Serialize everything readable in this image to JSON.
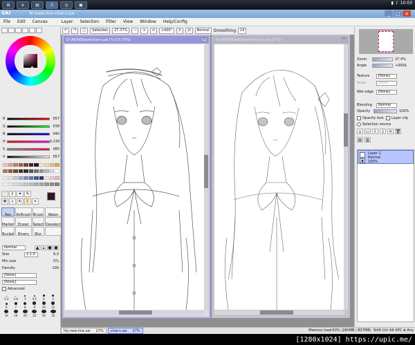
{
  "taskbar": {
    "app_name": "SAI",
    "file_label": "W:\\new-line-char-s.sai",
    "clock": "10:03"
  },
  "window": {
    "logo": "Paint Tool SAI",
    "title": "W:\\new-line-char-s.sai"
  },
  "menu": [
    "File",
    "Edit",
    "Canvas",
    "Layer",
    "Selection",
    "Filter",
    "View",
    "Window",
    "Help/Config"
  ],
  "toolbar": {
    "selection_label": "Selection",
    "zoom": "27.37%",
    "rotation": "+000°",
    "mode": "Normal",
    "smoothing_label": "Smoothing",
    "smoothing_value": "14"
  },
  "color": {
    "sliders": [
      {
        "label": "R",
        "value": "057",
        "colors": [
          "#000000",
          "#ff0000"
        ]
      },
      {
        "label": "G",
        "value": "038",
        "colors": [
          "#000000",
          "#00ff00"
        ]
      },
      {
        "label": "B",
        "value": "040",
        "colors": [
          "#000000",
          "#0000ff"
        ]
      },
      {
        "label": "H",
        "value": "S:230",
        "colors": [
          "#ff0000",
          "#ff00ff"
        ]
      },
      {
        "label": "S",
        "value": "085",
        "colors": [
          "#888888",
          "#ff0044"
        ]
      },
      {
        "label": "V",
        "value": "057",
        "colors": [
          "#000000",
          "#ffffff"
        ]
      }
    ],
    "swatches": [
      "#f3c9c2",
      "#e0a39a",
      "#c6836f",
      "#a06549",
      "#7a4b38",
      "#4a2a20",
      "#2c1a20",
      "#ffe6cc",
      "#ffd5a8",
      "#ecc189",
      "#d8a86a",
      "#b18255",
      "#8a6446",
      "#6d4c35",
      "#4b3322",
      "#333333",
      "#555555",
      "#777777",
      "#999999",
      "#bbbbbb",
      "#dddddd",
      "#ffffff",
      "#f0f0f0",
      "#e6e6e6",
      "#ccccdd",
      "#aab0cc",
      "#8890b8",
      "#6a7aa8",
      "#4a5a88",
      "#2a3a68",
      "#f7e4e4",
      "#edd0d0",
      "#e0bcbc",
      "#f5f5f5",
      "#eeeeee",
      "#e0e0e0",
      "#d8d8d8",
      "#cccccc",
      "#c0c0c0",
      "#b4b4b4",
      "#a8a8a8",
      "#9c9c9c",
      "#909090",
      "#848484"
    ]
  },
  "tools": {
    "brushes": [
      {
        "label": "Pen",
        "selected": true
      },
      {
        "label": "AirBrush",
        "selected": false
      },
      {
        "label": "Brush",
        "selected": false
      },
      {
        "label": "Water",
        "selected": false
      },
      {
        "label": "Marker",
        "selected": false
      },
      {
        "label": "Eraser",
        "selected": false
      },
      {
        "label": "Select",
        "selected": false
      },
      {
        "label": "Deselect",
        "selected": false
      },
      {
        "label": "Bucket",
        "selected": false
      },
      {
        "label": "Binary",
        "selected": false
      },
      {
        "label": "Blur",
        "selected": false
      },
      {
        "label": "",
        "selected": false
      }
    ],
    "blend_mode": "Normal",
    "size_label": "Size",
    "size_mult": "x 1.0",
    "size_value": "9.0",
    "min_size_label": "Min size",
    "min_size_value": "0%",
    "density_label": "Density",
    "density_value": "100",
    "texture_1": "[None]",
    "texture_2": "[None]",
    "advanced_label": "Advanced",
    "brush_sizes": [
      "2.3",
      "2.6",
      "3",
      "3.5",
      "4",
      "5",
      "6",
      "7",
      "8",
      "9",
      "10",
      "12",
      "14",
      "16",
      "20",
      "25",
      "30",
      "35"
    ]
  },
  "documents": [
    {
      "title": "D:\\AIDW\\Save\\char-s.sai (*) (27.37%)"
    },
    {
      "title": "D:\\AIDW\\Save\\new-line-char.sai (27%)"
    }
  ],
  "right_panel": {
    "zoom_label": "Zoom",
    "zoom_value": "27.4%",
    "angle_label": "Angle",
    "angle_value": "+000$",
    "texture_label": "Texture",
    "texture_value": "[None]",
    "scale_label": "Scale",
    "scale_value": "100%",
    "wet_edge_label": "Wet edge",
    "wet_edge_value": "[None]",
    "blend_label": "Blending",
    "blend_value": "Normal",
    "opacity_label": "Opacity",
    "opacity_value": "100%",
    "opacity_lock_label": "Opacity lock",
    "clip_label": "Layer clip",
    "selection_source_label": "Selection source",
    "layer_name": "Layer 1",
    "layer_mode": "Normal",
    "layer_opacity": "100%"
  },
  "tabs": [
    {
      "label": "lily-new-line.sai",
      "zoom": "27%",
      "active": false
    },
    {
      "label": "char-s.sai",
      "zoom": "27%",
      "active": true
    }
  ],
  "status": {
    "memory": "Memory load:63% (280MB / 837MB)",
    "keys": "Shift Ctrl Alt SPC ⊕ Any"
  },
  "caption": {
    "text": "[1280x1024] https://upic.me/"
  }
}
